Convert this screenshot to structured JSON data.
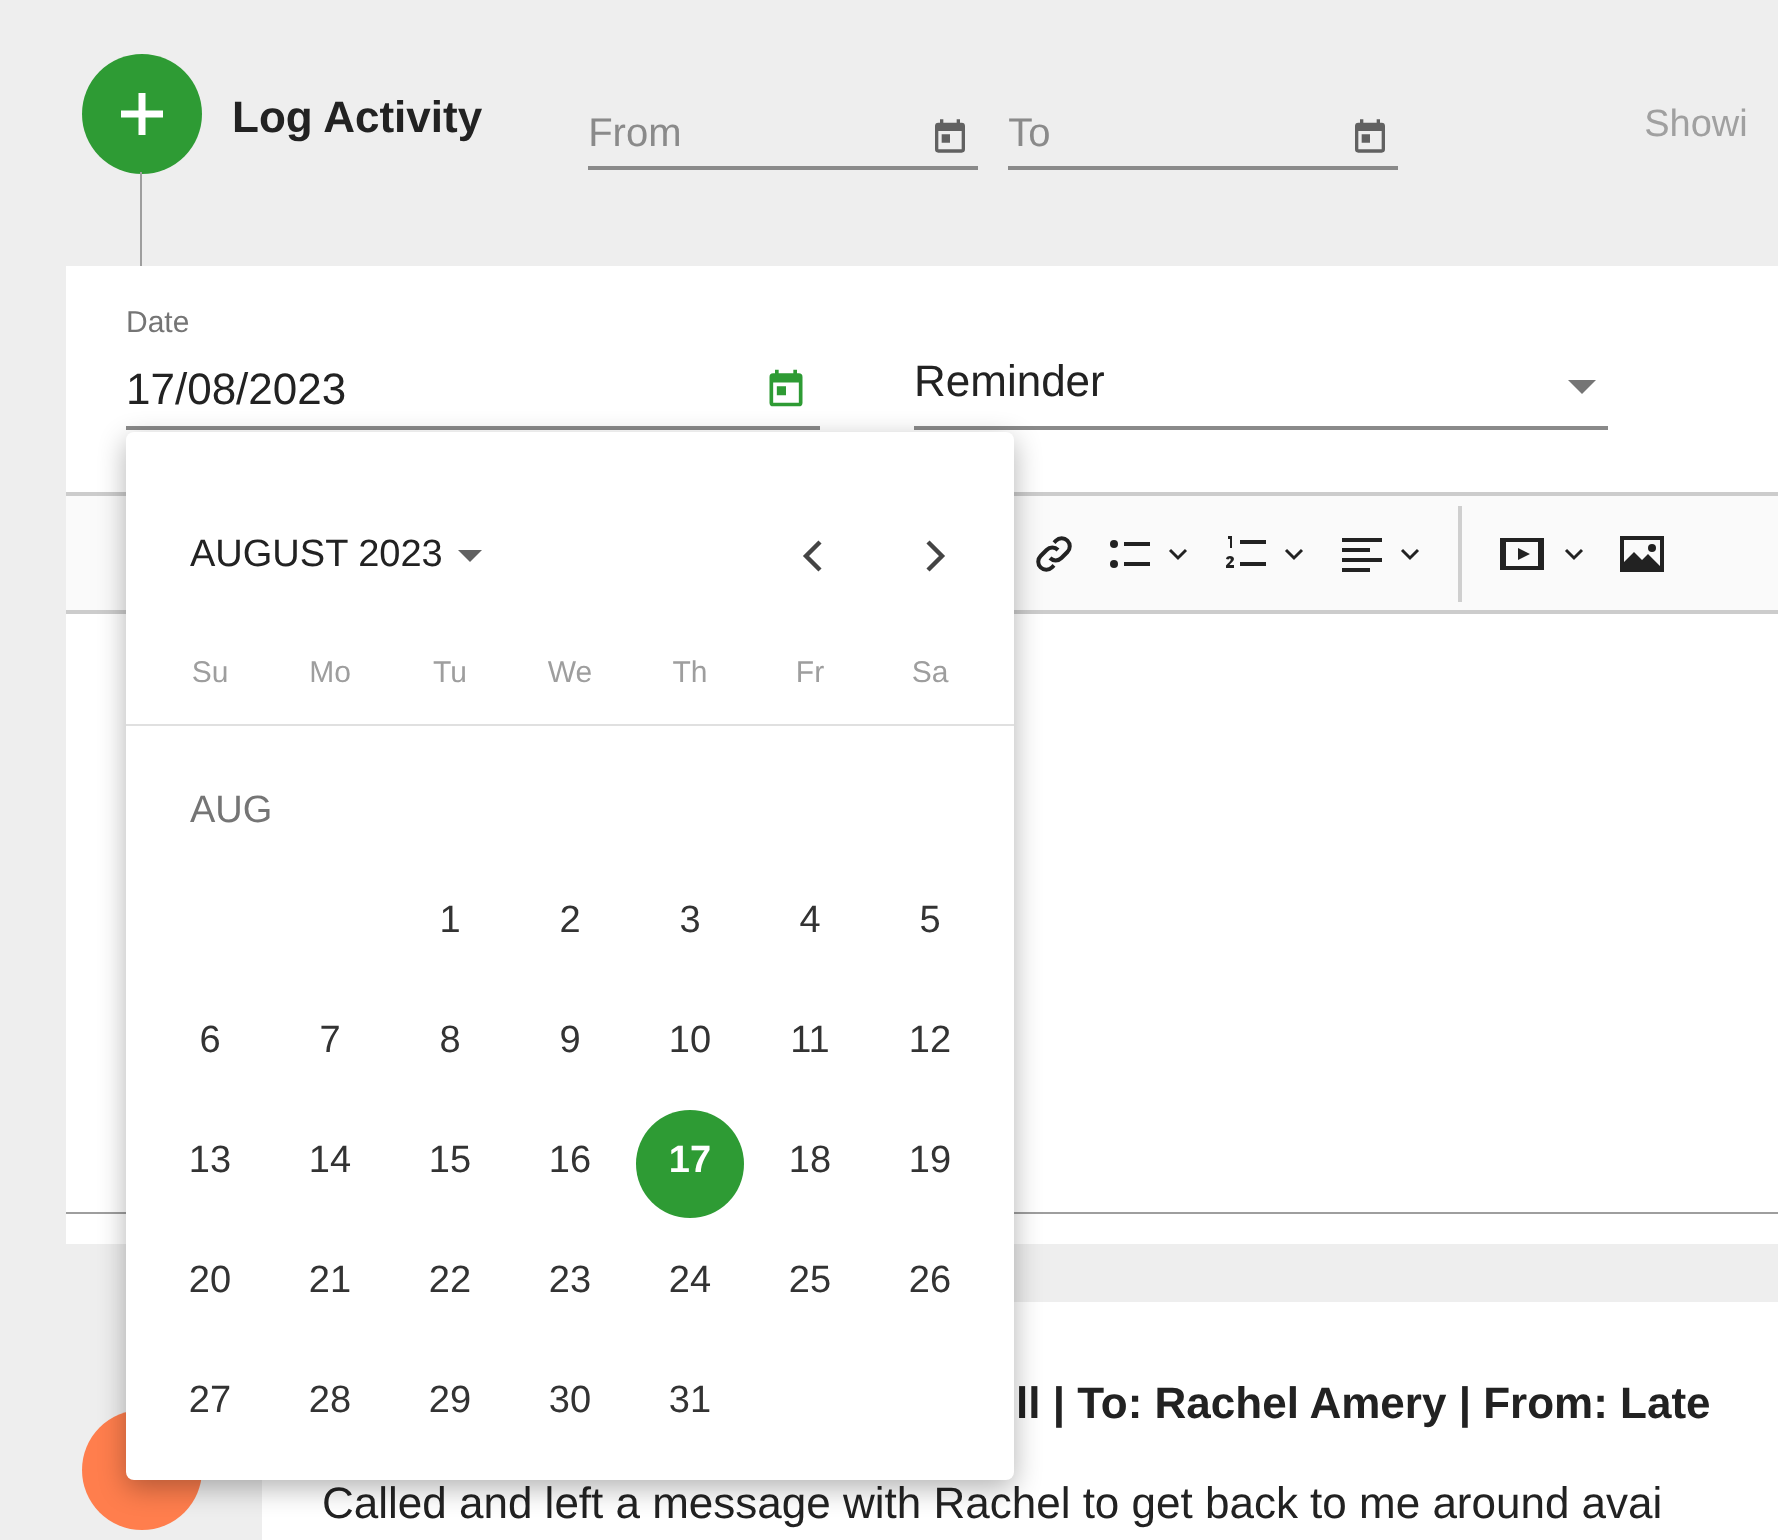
{
  "header": {
    "title": "Log Activity",
    "from_field": {
      "placeholder": "From"
    },
    "to_field": {
      "placeholder": "To"
    },
    "showing_text": "Showi"
  },
  "form": {
    "date_field": {
      "label": "Date",
      "value": "17/08/2023"
    },
    "type_select": {
      "value": "Reminder"
    },
    "toolbar": [
      {
        "kind": "link"
      },
      {
        "kind": "bullets"
      },
      {
        "kind": "numbers"
      },
      {
        "kind": "align"
      },
      {
        "kind": "divider"
      },
      {
        "kind": "video"
      },
      {
        "kind": "image"
      }
    ]
  },
  "calendar": {
    "month_label": "AUGUST 2023",
    "weekdays": [
      "Su",
      "Mo",
      "Tu",
      "We",
      "Th",
      "Fr",
      "Sa"
    ],
    "section_label": "AUG",
    "days": [
      {
        "label": "1",
        "selected": false
      },
      {
        "label": "2",
        "selected": false
      },
      {
        "label": "3",
        "selected": false
      },
      {
        "label": "4",
        "selected": false
      },
      {
        "label": "5",
        "selected": false
      },
      {
        "label": "6",
        "selected": false
      },
      {
        "label": "7",
        "selected": false
      },
      {
        "label": "8",
        "selected": false
      },
      {
        "label": "9",
        "selected": false
      },
      {
        "label": "10",
        "selected": false
      },
      {
        "label": "11",
        "selected": false
      },
      {
        "label": "12",
        "selected": false
      },
      {
        "label": "13",
        "selected": false
      },
      {
        "label": "14",
        "selected": false
      },
      {
        "label": "15",
        "selected": false
      },
      {
        "label": "16",
        "selected": false
      },
      {
        "label": "17",
        "selected": true
      },
      {
        "label": "18",
        "selected": false
      },
      {
        "label": "19",
        "selected": false
      },
      {
        "label": "20",
        "selected": false
      },
      {
        "label": "21",
        "selected": false
      },
      {
        "label": "22",
        "selected": false
      },
      {
        "label": "23",
        "selected": false
      },
      {
        "label": "24",
        "selected": false
      },
      {
        "label": "25",
        "selected": false
      },
      {
        "label": "26",
        "selected": false
      },
      {
        "label": "27",
        "selected": false
      },
      {
        "label": "28",
        "selected": false
      },
      {
        "label": "29",
        "selected": false
      },
      {
        "label": "30",
        "selected": false
      },
      {
        "label": "31",
        "selected": false
      }
    ]
  },
  "activity": {
    "title": "ll | To: Rachel Amery | From: Late",
    "message": "Called and left a message with Rachel to get back to me around avai"
  }
}
